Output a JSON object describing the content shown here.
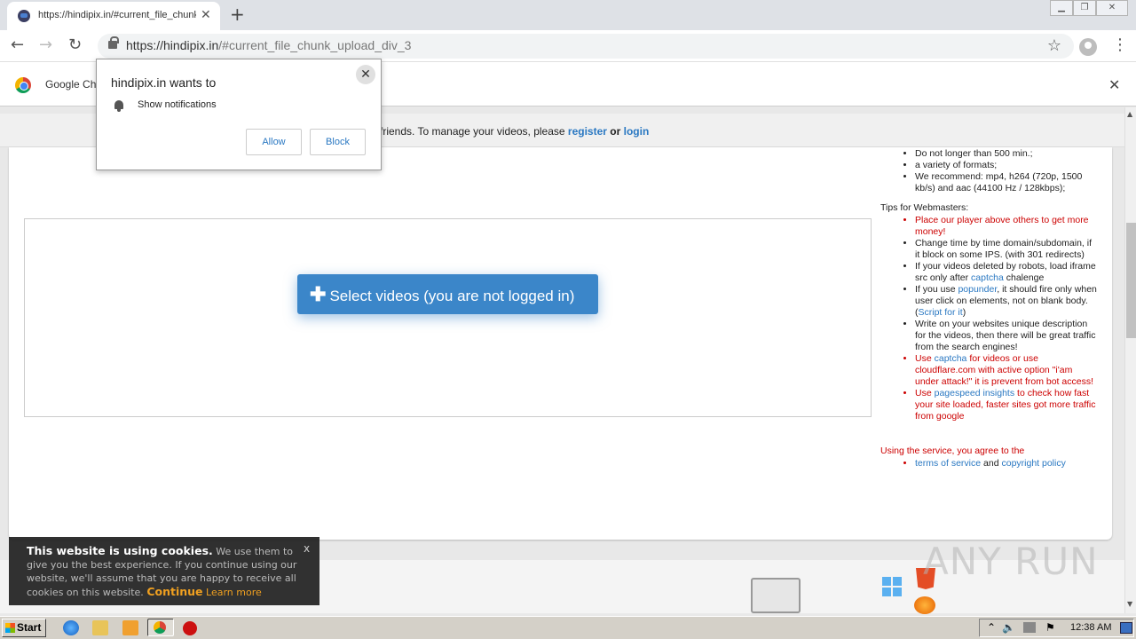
{
  "browser": {
    "tab_title": "https://hindipix.in/#current_file_chunk_upload_div_3",
    "url_host": "https://hindipix.in",
    "url_path": "/#current_file_chunk_upload_div_3",
    "infobar_text": "Google Ch"
  },
  "notification_popup": {
    "title": "hindipix.in wants to",
    "permission": "Show notifications",
    "allow_label": "Allow",
    "block_label": "Block"
  },
  "notice_bar": {
    "text": "friends. To manage your videos, please",
    "register": "register",
    "or": "or",
    "login": "login"
  },
  "upload": {
    "button_label": "Select videos (you are not logged in)"
  },
  "sidebar": {
    "requirements": [
      "Do not longer than 500 min.;",
      "a variety of formats;",
      "We recommend: mp4, h264 (720p, 1500 kb/s) and aac (44100 Hz / 128kbps);"
    ],
    "tips_heading": "Tips for Webmasters:",
    "tip1": "Place our player above others to get more money!",
    "tip2": "Change time by time domain/subdomain, if it block on some IPS. (with 301 redirects)",
    "tip3_a": "If your videos deleted by robots, load iframe src only after",
    "tip3_link": "captcha",
    "tip3_b": "chalenge",
    "tip4_a": "If you use",
    "tip4_link": "popunder",
    "tip4_b": ", it should fire only when user click on elements, not on blank body. (",
    "tip4_link2": "Script for it",
    "tip4_c": ")",
    "tip5": "Write on your websites unique description for the videos, then there will be great traffic from the search engines!",
    "tip6_a": "Use",
    "tip6_link": "captcha",
    "tip6_b": "for videos or use cloudflare.com with active option \"i'am under attack!\" it is prevent from bot access!",
    "tip7_a": "Use",
    "tip7_link": "pagespeed insights",
    "tip7_b": "to check how fast your site loaded, faster sites got more traffic from google",
    "agree": "Using the service, you agree to the",
    "terms": "terms of service",
    "and": "and",
    "policy": "copyright policy"
  },
  "cookie": {
    "title": "This website is using cookies.",
    "body": "We use them to give you the best experience. If you continue using our website, we'll assume that you are happy to receive all cookies on this website.",
    "continue": "Continue",
    "learn_more": "Learn more",
    "close": "x"
  },
  "watermark": "ANY RUN",
  "taskbar": {
    "start": "Start",
    "clock": "12:38 AM"
  }
}
